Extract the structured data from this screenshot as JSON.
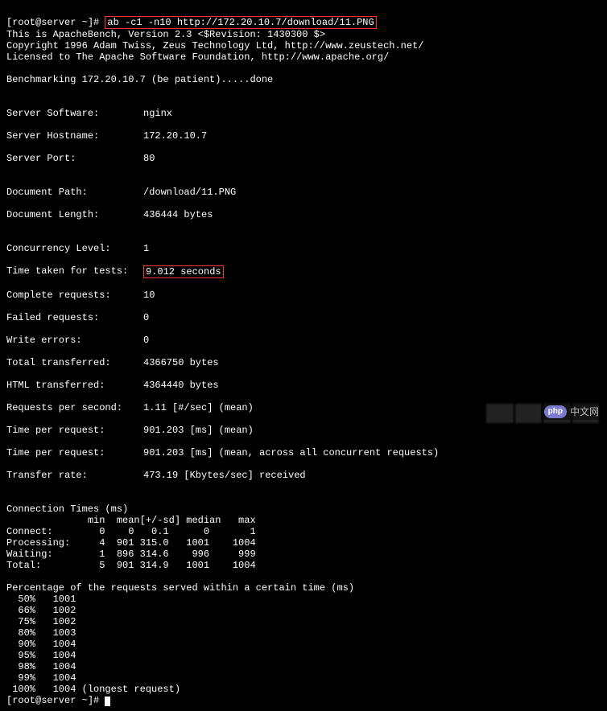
{
  "prompt_line": {
    "prefix": "[root@server ~]# ",
    "command": "ab -c1 -n10 http://172.20.10.7/download/11.PNG"
  },
  "header": {
    "line1": "This is ApacheBench, Version 2.3 <$Revision: 1430300 $>",
    "line2": "Copyright 1996 Adam Twiss, Zeus Technology Ltd, http://www.zeustech.net/",
    "line3": "Licensed to The Apache Software Foundation, http://www.apache.org/"
  },
  "benchmarking": "Benchmarking 172.20.10.7 (be patient).....done",
  "server_info": [
    {
      "label": "Server Software:",
      "value": "nginx"
    },
    {
      "label": "Server Hostname:",
      "value": "172.20.10.7"
    },
    {
      "label": "Server Port:",
      "value": "80"
    }
  ],
  "document_info": [
    {
      "label": "Document Path:",
      "value": "/download/11.PNG"
    },
    {
      "label": "Document Length:",
      "value": "436444 bytes"
    }
  ],
  "results": [
    {
      "label": "Concurrency Level:",
      "value": "1",
      "highlight": false
    },
    {
      "label": "Time taken for tests:",
      "value": "9.012 seconds",
      "highlight": true
    },
    {
      "label": "Complete requests:",
      "value": "10",
      "highlight": false
    },
    {
      "label": "Failed requests:",
      "value": "0",
      "highlight": false
    },
    {
      "label": "Write errors:",
      "value": "0",
      "highlight": false
    },
    {
      "label": "Total transferred:",
      "value": "4366750 bytes",
      "highlight": false
    },
    {
      "label": "HTML transferred:",
      "value": "4364440 bytes",
      "highlight": false
    },
    {
      "label": "Requests per second:",
      "value": "1.11 [#/sec] (mean)",
      "highlight": false
    },
    {
      "label": "Time per request:",
      "value": "901.203 [ms] (mean)",
      "highlight": false
    },
    {
      "label": "Time per request:",
      "value": "901.203 [ms] (mean, across all concurrent requests)",
      "highlight": false
    },
    {
      "label": "Transfer rate:",
      "value": "473.19 [Kbytes/sec] received",
      "highlight": false
    }
  ],
  "conn_times": {
    "title": "Connection Times (ms)",
    "header": "              min  mean[+/-sd] median   max",
    "rows": [
      "Connect:        0    0   0.1      0       1",
      "Processing:     4  901 315.0   1001    1004",
      "Waiting:        1  896 314.6    996     999",
      "Total:          5  901 314.9   1001    1004"
    ]
  },
  "percentages": {
    "title": "Percentage of the requests served within a certain time (ms)",
    "rows": [
      "  50%   1001",
      "  66%   1002",
      "  75%   1002",
      "  80%   1003",
      "  90%   1004",
      "  95%   1004",
      "  98%   1004",
      "  99%   1004",
      " 100%   1004 (longest request)"
    ]
  },
  "end_prompt": "[root@server ~]# ",
  "watermark": {
    "badge": "php",
    "text": "中文网"
  }
}
